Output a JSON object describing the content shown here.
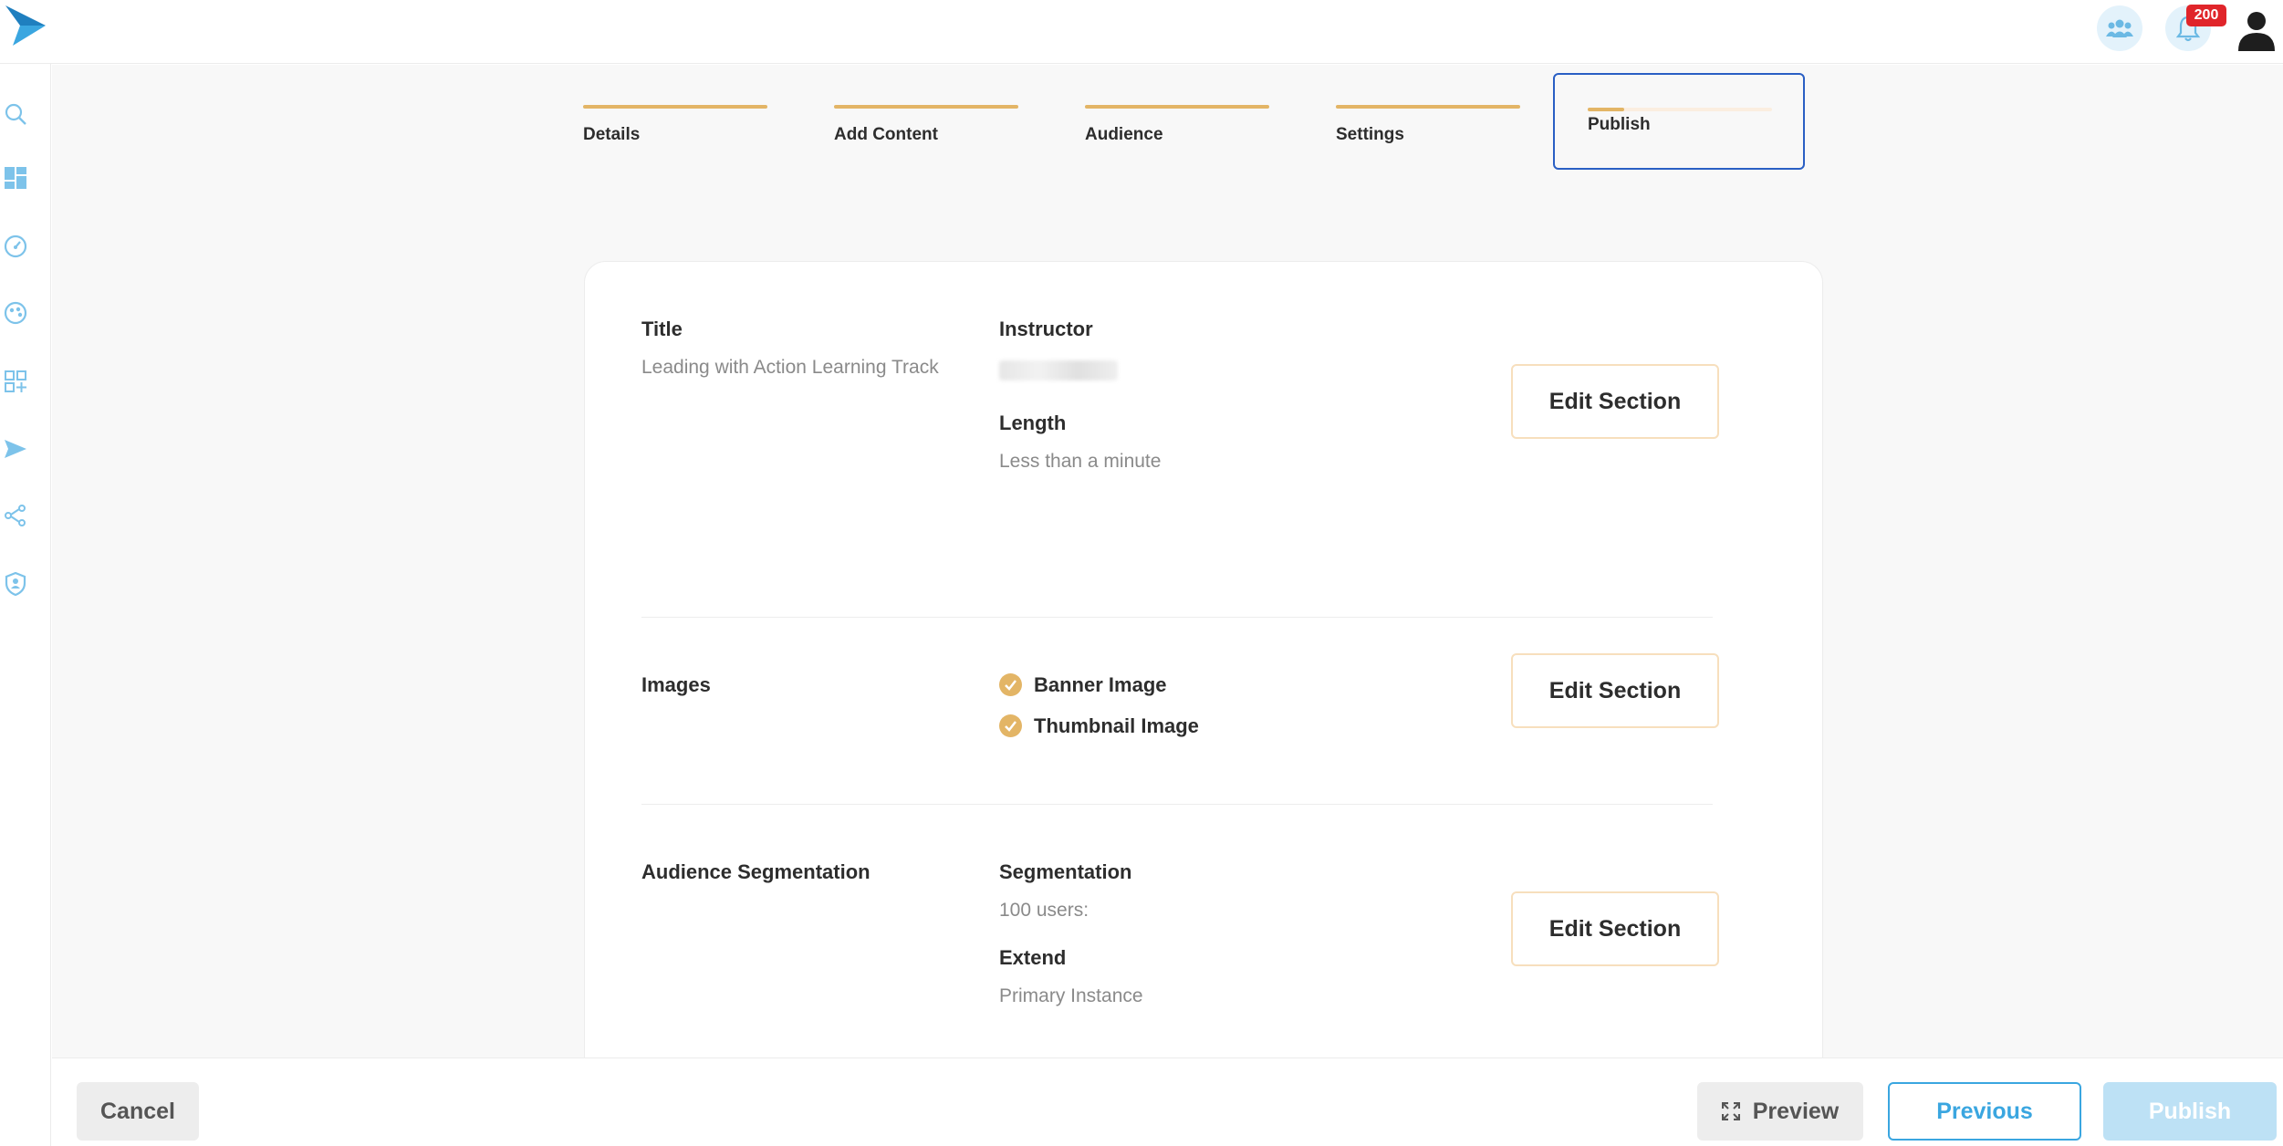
{
  "header": {
    "logo_icon": "paper-plane-logo-icon",
    "notification_count": "200"
  },
  "sidebar": {
    "items": [
      {
        "icon": "search-icon"
      },
      {
        "icon": "dashboard-icon"
      },
      {
        "icon": "speedometer-icon"
      },
      {
        "icon": "palette-icon"
      },
      {
        "icon": "add-widget-icon"
      },
      {
        "icon": "send-icon"
      },
      {
        "icon": "share-icon"
      },
      {
        "icon": "shield-icon"
      }
    ]
  },
  "stepper": {
    "steps": [
      {
        "label": "Details"
      },
      {
        "label": "Add Content"
      },
      {
        "label": "Audience"
      },
      {
        "label": "Settings"
      },
      {
        "label": "Publish",
        "progress": 0.2
      }
    ]
  },
  "summary": {
    "title_section": {
      "title_label": "Title",
      "title_value": "Leading with Action Learning Track",
      "instructor_label": "Instructor",
      "length_label": "Length",
      "length_value": "Less than a minute",
      "edit_label": "Edit Section"
    },
    "images_section": {
      "label": "Images",
      "items": [
        "Banner Image",
        "Thumbnail Image"
      ],
      "edit_label": "Edit Section"
    },
    "audience_section": {
      "label": "Audience Segmentation",
      "segmentation_label": "Segmentation",
      "segmentation_value": "100 users:",
      "extend_label": "Extend",
      "extend_value": "Primary Instance",
      "edit_label": "Edit Section"
    }
  },
  "footer": {
    "cancel_label": "Cancel",
    "preview_label": "Preview",
    "previous_label": "Previous",
    "publish_label": "Publish"
  },
  "colors": {
    "accent_gold": "#e3b566",
    "primary_blue": "#3aa6e0",
    "active_border": "#2a5fc4",
    "badge_red": "#e0252a"
  }
}
